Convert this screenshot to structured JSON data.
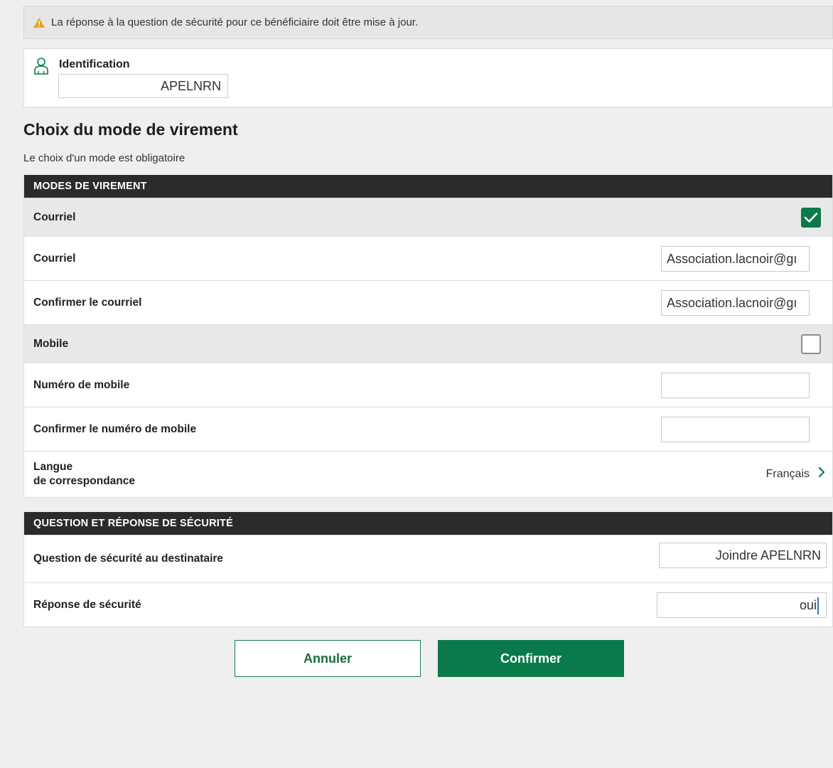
{
  "alert": {
    "text": "La réponse à la question de sécurité pour ce bénéficiaire doit être mise à jour."
  },
  "identification": {
    "label": "Identification",
    "value": "APELNRN"
  },
  "transfer_mode": {
    "title": "Choix du mode de virement",
    "note": "Le choix d'un mode est obligatoire",
    "header": "MODES DE VIREMENT",
    "courriel_option": {
      "label": "Courriel",
      "checked": true
    },
    "courriel_field": {
      "label": "Courriel",
      "value": "Association.lacnoir@gı"
    },
    "courriel_confirm": {
      "label": "Confirmer le courriel",
      "value": "Association.lacnoir@gı"
    },
    "mobile_option": {
      "label": "Mobile",
      "checked": false
    },
    "mobile_field": {
      "label": "Numéro de mobile",
      "value": ""
    },
    "mobile_confirm": {
      "label": "Confirmer le numéro de mobile",
      "value": ""
    },
    "language": {
      "label_line1": "Langue",
      "label_line2": "de correspondance",
      "value": "Français"
    }
  },
  "security": {
    "header": "QUESTION ET RÉPONSE DE SÉCURITÉ",
    "question": {
      "label": "Question de sécurité au destinataire",
      "value": "Joindre  APELNRN"
    },
    "answer": {
      "label": "Réponse de sécurité",
      "value": "oui"
    }
  },
  "buttons": {
    "cancel": "Annuler",
    "confirm": "Confirmer"
  },
  "colors": {
    "accent": "#0b7a4a",
    "header_bg": "#2b2b2b",
    "warning": "#e8a317"
  }
}
